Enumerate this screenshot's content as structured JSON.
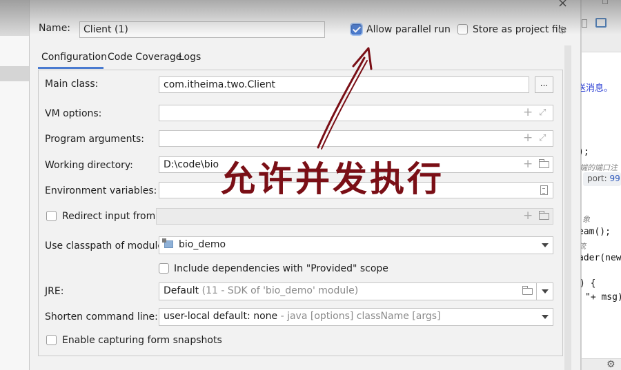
{
  "dialog": {
    "name_label": "Name:",
    "name_value": "Client (1)",
    "allow_parallel_label": "Allow parallel run",
    "allow_parallel_checked": true,
    "store_project_label": "Store as project file",
    "store_project_checked": false
  },
  "tabs": [
    {
      "label": "Configuration",
      "active": true
    },
    {
      "label": "Code Coverage",
      "active": false
    },
    {
      "label": "Logs",
      "active": false
    }
  ],
  "form": {
    "main_class_label": "Main class:",
    "main_class_value": "com.itheima.two.Client",
    "browse_label": "...",
    "vm_options_label": "VM options:",
    "vm_options_value": "",
    "program_args_label": "Program arguments:",
    "program_args_value": "",
    "working_dir_label": "Working directory:",
    "working_dir_value": "D:\\code\\bio",
    "env_vars_label": "Environment variables:",
    "env_vars_value": "",
    "redirect_label": "Redirect input from:",
    "redirect_checked": false,
    "module_label": "Use classpath of module:",
    "module_value": "bio_demo",
    "include_deps_label": "Include dependencies with \"Provided\" scope",
    "include_deps_checked": false,
    "jre_label": "JRE:",
    "jre_value": "Default",
    "jre_hint": "(11 - SDK of 'bio_demo' module)",
    "shorten_label": "Shorten command line:",
    "shorten_value": "user-local default: none",
    "shorten_hint": "- java [options] className [args]",
    "snapshots_label": "Enable capturing form snapshots",
    "snapshots_checked": false
  },
  "annotation": {
    "text": "允许并发执行",
    "color": "#7a0f16"
  },
  "background_code": {
    "line1": "送消息。",
    "line2": ");",
    "line3": "端的端口注",
    "port_hint_label": "port:",
    "port_hint_value": "99",
    "line4": "象",
    "line5": "eam();",
    "line6": "流",
    "line7_a": "ader(",
    "line7_b": "new",
    "line8": ") {",
    "line9": "\"+ msg)"
  },
  "icons": {
    "close": "close-icon",
    "settings": "gear-icon",
    "expand": "expand-icon",
    "add": "plus-icon",
    "folder": "folder-icon",
    "document": "document-icon",
    "module": "module-icon",
    "dropdown": "chevron-down-icon"
  },
  "colors": {
    "accent": "#4a7bd0",
    "dialog_bg": "#f2f2f2",
    "annotation": "#7a0f16"
  }
}
